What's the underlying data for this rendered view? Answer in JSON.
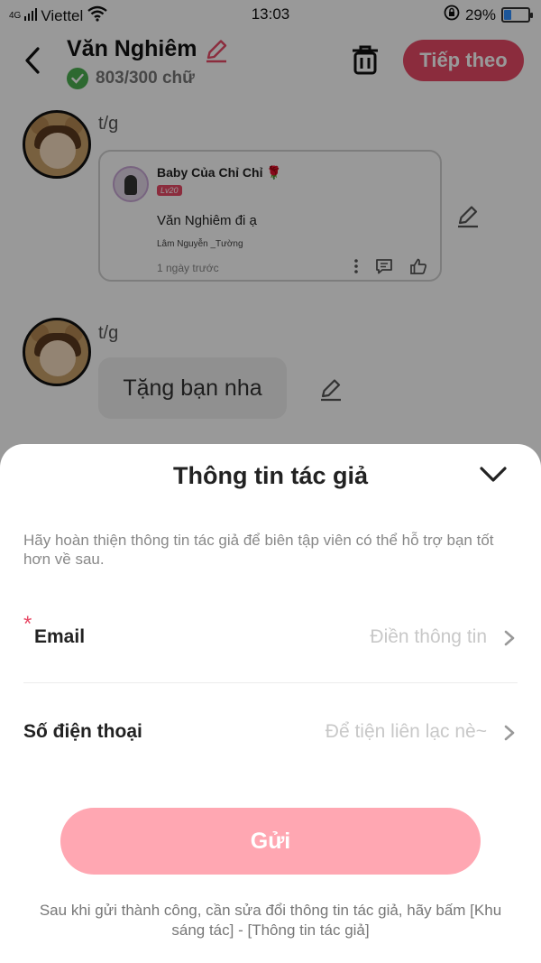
{
  "status_bar": {
    "network": "4G",
    "carrier": "Viettel",
    "time": "13:03",
    "battery": "29%",
    "battery_level": 0.29
  },
  "header": {
    "title": "Văn Nghiêm",
    "word_count": "803/300 chữ",
    "next_label": "Tiếp theo"
  },
  "messages": [
    {
      "time_label": "t/g",
      "card": {
        "user": "Baby Của Chỉ Chỉ 🌹",
        "level": "Lv20",
        "text": "Văn Nghiêm đi ạ",
        "subtext": "Lâm Nguyễn _Tường",
        "time": "1 ngày trước"
      }
    },
    {
      "time_label": "t/g",
      "text": "Tặng bạn nha"
    }
  ],
  "sheet": {
    "title": "Thông tin tác giả",
    "description": "Hãy hoàn thiện thông tin tác giả để biên tập viên có thể hỗ trợ bạn tốt hơn về sau.",
    "required_mark": "*",
    "fields": [
      {
        "label": "Email",
        "placeholder": "Điền thông tin"
      },
      {
        "label": "Số điện thoại",
        "placeholder": "Để tiện liên lạc nè~"
      }
    ],
    "submit_label": "Gửi",
    "footer": "Sau khi gửi thành công, cần sửa đổi thông tin tác giả, hãy bấm [Khu sáng tác] - [Thông tin tác giả]"
  },
  "colors": {
    "accent": "#e84a66",
    "submit_disabled": "#ffa7b2"
  }
}
